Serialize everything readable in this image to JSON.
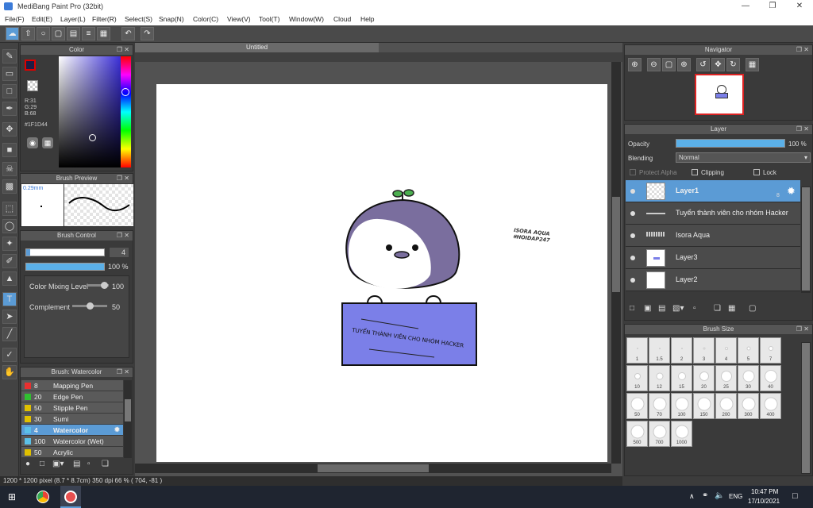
{
  "window": {
    "title": "MediBang Paint Pro (32bit)"
  },
  "menu": [
    "File(F)",
    "Edit(E)",
    "Layer(L)",
    "Filter(R)",
    "Select(S)",
    "Snap(N)",
    "Color(C)",
    "View(V)",
    "Tool(T)",
    "Window(W)",
    "Cloud",
    "Help"
  ],
  "color_panel": {
    "title": "Color",
    "r": "R:31",
    "g": "G:29",
    "b": "B:68",
    "hex": "#1F1D44",
    "fg": "#1f1d44"
  },
  "brush_preview": {
    "title": "Brush Preview",
    "size": "0.29mm"
  },
  "brush_control": {
    "title": "Brush Control",
    "size_value": "4",
    "opacity_value": "100 %",
    "color_mixing_label": "Color Mixing Level",
    "color_mixing_value": "100",
    "complement_label": "Complement",
    "complement_value": "50"
  },
  "brush_list": {
    "title": "Brush: Watercolor",
    "items": [
      {
        "n": "8",
        "name": "Mapping Pen",
        "color": "#e83030"
      },
      {
        "n": "20",
        "name": "Edge Pen",
        "color": "#30c030"
      },
      {
        "n": "50",
        "name": "Stipple Pen",
        "color": "#e0c000"
      },
      {
        "n": "30",
        "name": "Sumi",
        "color": "#e0c000"
      },
      {
        "n": "4",
        "name": "Watercolor",
        "color": "#5bc0e8",
        "selected": true
      },
      {
        "n": "100",
        "name": "Watercolor (Wet)",
        "color": "#5bc0e8"
      },
      {
        "n": "50",
        "name": "Acrylic",
        "color": "#e0c000"
      }
    ]
  },
  "canvas": {
    "tab": "Untitled",
    "sign_text": "TUYỂN THÀNH VIÊN CHO NHÓM HACKER",
    "watermark_line1": "ISORA AQUA",
    "watermark_line2": "#HOIDAP247"
  },
  "navigator": {
    "title": "Navigator"
  },
  "layer_panel": {
    "title": "Layer",
    "opacity_label": "Opacity",
    "opacity_value": "100 %",
    "blending_label": "Blending",
    "blending_value": "Normal",
    "protect_alpha": "Protect Alpha",
    "clipping": "Clipping",
    "lock": "Lock",
    "layers": [
      {
        "name": "Layer1",
        "selected": true,
        "badge": "8"
      },
      {
        "name": "Tuyển thành viên cho nhóm Hacker"
      },
      {
        "name": "Isora Aqua"
      },
      {
        "name": "Layer3"
      },
      {
        "name": "Layer2"
      }
    ]
  },
  "brush_size": {
    "title": "Brush Size",
    "sizes": [
      "1",
      "1.5",
      "2",
      "3",
      "4",
      "5",
      "7",
      "10",
      "12",
      "15",
      "20",
      "25",
      "30",
      "40",
      "50",
      "70",
      "100",
      "150",
      "200",
      "300",
      "400",
      "500",
      "700",
      "1000"
    ]
  },
  "status": {
    "text": "1200 * 1200 pixel  (8.7 * 8.7cm)  350 dpi  66 %  ( 704, -81 )"
  },
  "taskbar": {
    "lang": "ENG",
    "time": "10:47 PM",
    "date": "17/10/2021"
  }
}
